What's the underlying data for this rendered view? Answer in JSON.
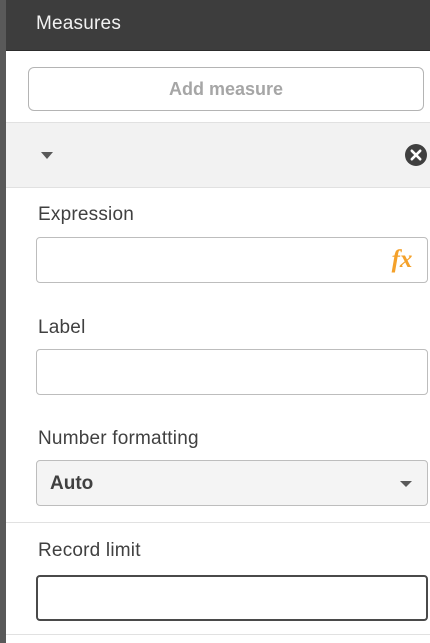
{
  "panel": {
    "title": "Measures",
    "add_measure_label": "Add measure"
  },
  "measure": {
    "expression": {
      "label": "Expression",
      "value": "",
      "fx_label": "fx"
    },
    "label_field": {
      "label": "Label",
      "value": ""
    },
    "number_formatting": {
      "label": "Number formatting",
      "selected": "Auto"
    },
    "record_limit": {
      "label": "Record limit",
      "value": ""
    }
  },
  "colors": {
    "header_bg": "#3d3d3d",
    "fx_accent": "#f4a12a",
    "section_bg": "#f2f2f2"
  },
  "icons": {
    "collapse": "triangle-down-icon",
    "remove": "close-circle-icon",
    "select_caret": "caret-down-icon"
  }
}
